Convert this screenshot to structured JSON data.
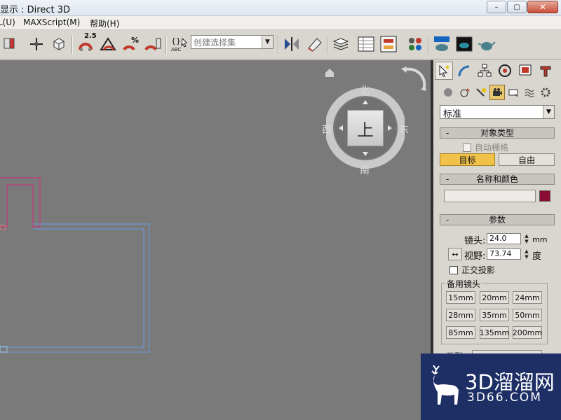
{
  "window": {
    "title": "显示 : Direct 3D",
    "buttons": {
      "minimize": "–",
      "maximize": "▢",
      "close": "✕"
    }
  },
  "menubar": {
    "items": [
      {
        "label": "L(U)"
      },
      {
        "label": "MAXScript(M)"
      },
      {
        "label": "帮助(H)"
      }
    ]
  },
  "toolbar": {
    "selection_set_placeholder": "创建选择集",
    "snap_25_label": "2.5",
    "icons": [
      "layer-manager-icon",
      "select-move-icon",
      "select-object-icon",
      "snap-25-icon",
      "angle-snap-icon",
      "percent-snap-icon",
      "spinner-snap-icon",
      "edit-named-selection-icon",
      "mirror-icon",
      "align-icon",
      "layer-icon",
      "curve-editor-icon",
      "schematic-view-icon",
      "material-editor-icon",
      "render-setup-icon",
      "rendered-frame-icon",
      "render-teapot-icon"
    ]
  },
  "viewcube": {
    "top_face": "上",
    "north": "北",
    "south": "南",
    "west": "西",
    "east": "东"
  },
  "command_panel": {
    "tabs": [
      "create-tab",
      "modify-tab",
      "hierarchy-tab",
      "motion-tab",
      "display-tab",
      "utilities-tab"
    ],
    "subtabs": [
      "geometry-subtab",
      "shapes-subtab",
      "lights-subtab",
      "cameras-subtab",
      "helpers-subtab",
      "spacewarps-subtab",
      "systems-subtab"
    ],
    "category_dropdown": "标准",
    "object_type": {
      "header": "对象类型",
      "autogrid_label": "自动栅格",
      "target_button": "目标",
      "free_button": "自由"
    },
    "name_color": {
      "header": "名称和颜色",
      "name_value": "",
      "color": "#8a0b34"
    },
    "parameters": {
      "header": "参数",
      "lens_label": "镜头:",
      "lens_value": "24.0",
      "lens_unit": "mm",
      "fov_label": "视野:",
      "fov_value": "73.74",
      "fov_unit": "度",
      "ortho_label": "正交投影",
      "stock_lenses_title": "备用镜头",
      "stock_lenses": [
        "15mm",
        "20mm",
        "24mm",
        "28mm",
        "35mm",
        "50mm",
        "85mm",
        "135mm",
        "200mm"
      ],
      "type_label": "类型:"
    }
  },
  "watermark": {
    "line1": "3D溜溜网",
    "line2": "3D66.COM"
  },
  "colors": {
    "viewport_bg": "#7a7a7a",
    "active_button": "#f0c24a",
    "scene_object_pink": "#b8457a",
    "scene_object_blue": "#6e8fc4",
    "watermark_bg": "#1e2f66"
  }
}
